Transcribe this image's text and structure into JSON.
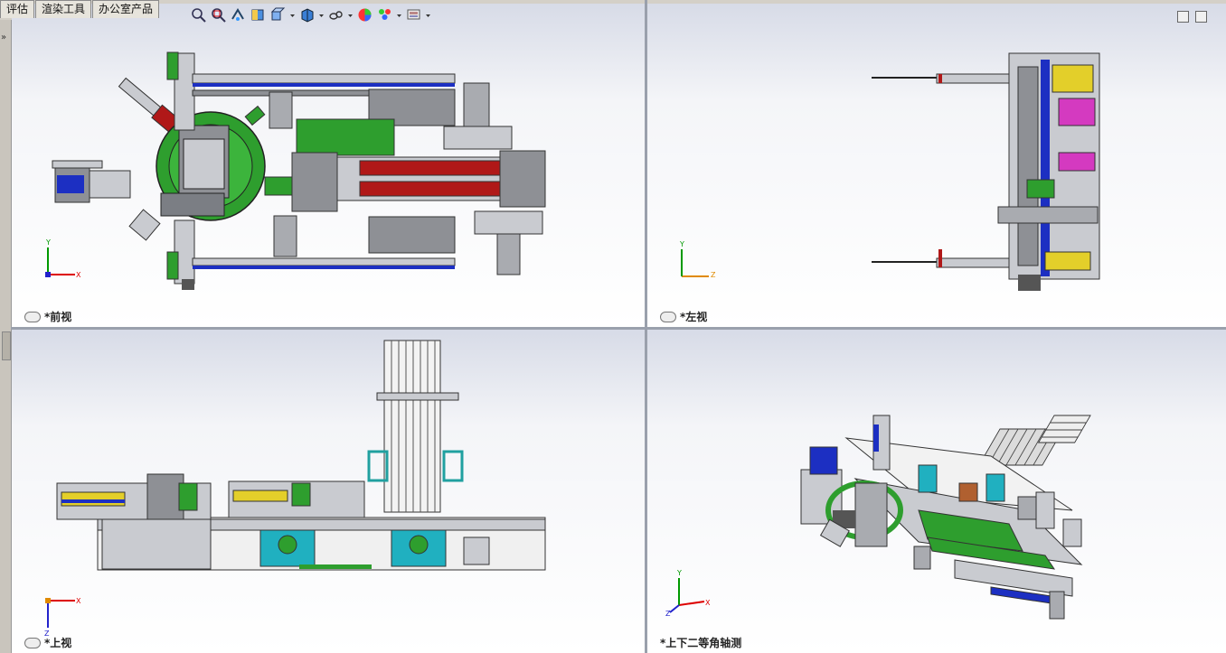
{
  "tabs": [
    "评估",
    "渲染工具",
    "办公室产品"
  ],
  "toolbar_icons": [
    "zoom-to-fit-icon",
    "zoom-area-icon",
    "previous-view-icon",
    "section-view-icon",
    "view-orientation-icon",
    "display-style-icon",
    "hide-show-icon",
    "edit-appearance-icon",
    "apply-scene-icon",
    "view-settings-icon"
  ],
  "viewports": {
    "front": {
      "label": "*前视",
      "axes": [
        "Y",
        "X"
      ]
    },
    "left": {
      "label": "*左视",
      "axes": [
        "Y",
        "Z"
      ]
    },
    "top": {
      "label": "*上视",
      "axes": [
        "X",
        "Z"
      ]
    },
    "iso": {
      "label": "*上下二等角轴测",
      "axes": [
        "Y",
        "X",
        "Z"
      ]
    }
  },
  "colors": {
    "green": "#2e9e2e",
    "red": "#b01818",
    "blue": "#1c2fc2",
    "gray": "#8e9095",
    "steel": "#c9cbd0",
    "yellow": "#e3cf2a"
  }
}
